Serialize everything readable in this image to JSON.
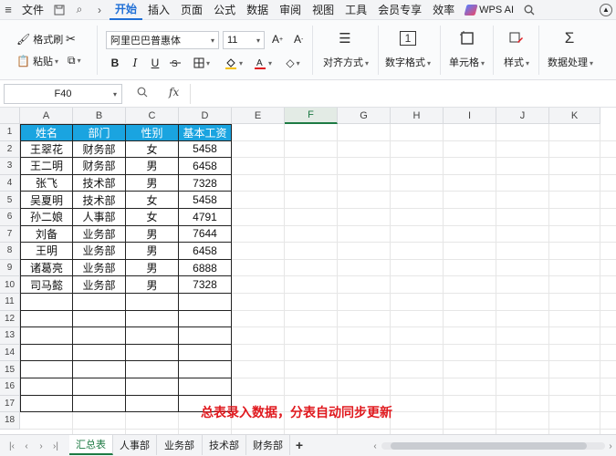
{
  "menubar": {
    "file": "文件",
    "tabs": [
      "开始",
      "插入",
      "页面",
      "公式",
      "数据",
      "审阅",
      "视图",
      "工具",
      "会员专享",
      "效率"
    ],
    "active_tab": "开始",
    "wps_ai": "WPS AI"
  },
  "ribbon": {
    "format_painter": "格式刷",
    "paste": "粘贴",
    "font_name": "阿里巴巴普惠体",
    "font_size": "11",
    "bold": "B",
    "italic": "I",
    "underline": "U",
    "align": "对齐方式",
    "number_format": "数字格式",
    "cell": "单元格",
    "style": "样式",
    "data_process": "数据处理"
  },
  "formula_bar": {
    "cell_ref": "F40",
    "fx": "fx",
    "value": ""
  },
  "grid": {
    "columns": [
      "A",
      "B",
      "C",
      "D",
      "E",
      "F",
      "G",
      "H",
      "I",
      "J",
      "K"
    ],
    "selected_column": "F",
    "rows": [
      "1",
      "2",
      "3",
      "4",
      "5",
      "6",
      "7",
      "8",
      "9",
      "10",
      "11",
      "12",
      "13",
      "14",
      "15",
      "16",
      "17",
      "18"
    ],
    "table_header": [
      "姓名",
      "部门",
      "性别",
      "基本工资"
    ],
    "table_rows": [
      [
        "王翠花",
        "财务部",
        "女",
        "5458"
      ],
      [
        "王二明",
        "财务部",
        "男",
        "6458"
      ],
      [
        "张飞",
        "技术部",
        "男",
        "7328"
      ],
      [
        "吴夏明",
        "技术部",
        "女",
        "5458"
      ],
      [
        "孙二娘",
        "人事部",
        "女",
        "4791"
      ],
      [
        "刘备",
        "业务部",
        "男",
        "7644"
      ],
      [
        "王明",
        "业务部",
        "男",
        "6458"
      ],
      [
        "诸葛亮",
        "业务部",
        "男",
        "6888"
      ],
      [
        "司马懿",
        "业务部",
        "男",
        "7328"
      ]
    ],
    "empty_bordered_rows": 7,
    "note": "总表录入数据，分表自动同步更新"
  },
  "sheets": {
    "tabs": [
      "汇总表",
      "人事部",
      "业务部",
      "技术部",
      "财务部"
    ],
    "active": "汇总表",
    "add": "+"
  },
  "colors": {
    "accent": "#1f6fd6",
    "header_fill": "#1aa4e0",
    "note": "#e0191e",
    "sheet_active": "#1d7a43"
  }
}
